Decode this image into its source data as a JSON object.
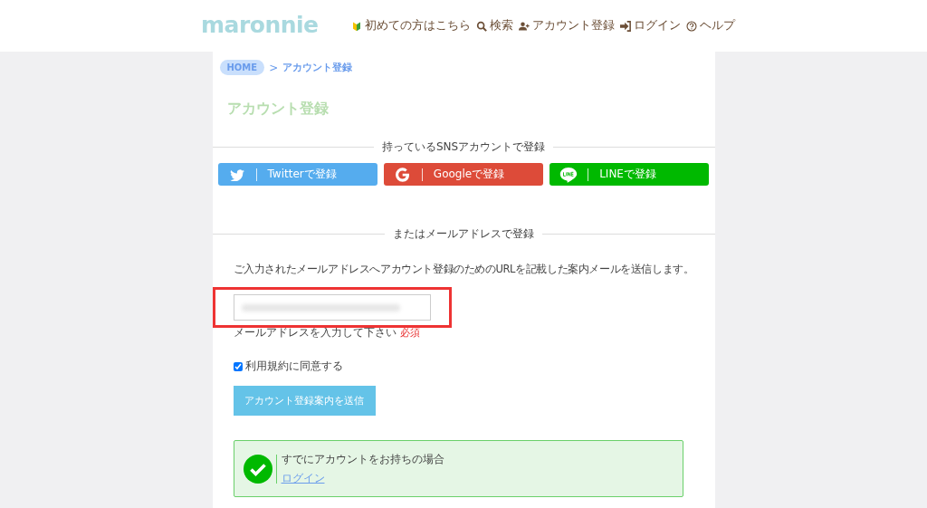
{
  "header": {
    "logo": "maronnie",
    "nav": [
      {
        "kind": "beginner",
        "label": "初めての方はこちら"
      },
      {
        "kind": "search",
        "label": "検索"
      },
      {
        "kind": "signup",
        "label": "アカウント登録"
      },
      {
        "kind": "login",
        "label": "ログイン"
      },
      {
        "kind": "help",
        "label": "ヘルプ"
      }
    ]
  },
  "breadcrumb": [
    {
      "label": "HOME",
      "kind": "home"
    },
    {
      "label": "アカウント登録",
      "kind": "current"
    }
  ],
  "breadcrumb_separator": ">",
  "page_title": "アカウント登録",
  "sns_heading": "持っているSNSアカウントで登録",
  "sns_buttons": [
    {
      "kind": "twitter",
      "label": "Twitterで登録",
      "color": "#55acee"
    },
    {
      "kind": "google",
      "label": "Googleで登録",
      "color": "#dd4b39"
    },
    {
      "kind": "line",
      "label": "LINEで登録",
      "color": "#00b900"
    }
  ],
  "email_heading": "またはメールアドレスで登録",
  "description": "ご入力されたメールアドレスへアカウント登録のためのURLを記載した案内メールを送信します。",
  "email_field": {
    "redacted": true,
    "highlighted": true,
    "label": "メールアドレスを入力して下さい",
    "required": "必須"
  },
  "terms": {
    "label": "利用規約に同意する",
    "checked": true
  },
  "submit": "アカウント登録案内を送信",
  "login_notice": {
    "text": "すでにアカウントをお持ちの場合",
    "link": "ログイン"
  }
}
